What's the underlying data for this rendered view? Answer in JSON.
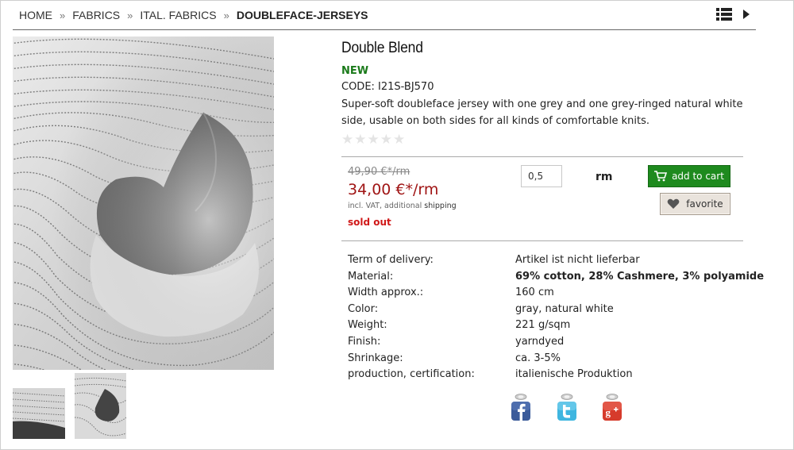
{
  "breadcrumb": {
    "items": [
      "HOME",
      "FABRICS",
      "ITAL. FABRICS"
    ],
    "separator": "»",
    "current": "DOUBLEFACE-JERSEYS"
  },
  "nav_icons": [
    "list-view-icon",
    "next-arrow-icon"
  ],
  "product": {
    "title": "Double Blend",
    "badge": "NEW",
    "code": "CODE: I21S-BJ570",
    "description": "Super-soft doubleface jersey with one grey and one grey-ringed natural white side, usable on both sides for all kinds of comfortable knits.",
    "rating_stars": 5,
    "rating_value": 0
  },
  "pricing": {
    "old_price": "49,90 €*/rm",
    "price": "34,00 €*/rm",
    "vat_prefix": "incl. VAT, additional",
    "vat_link": "shipping",
    "availability": "sold out"
  },
  "order": {
    "quantity": "0,5",
    "unit": "rm",
    "add_to_cart_label": "add to cart",
    "favorite_label": "favorite"
  },
  "specs": [
    {
      "key": "Term of delivery:",
      "value": "Artikel ist nicht lieferbar"
    },
    {
      "key": "Material:",
      "value": "69% cotton, 28% Cashmere, 3% polyamide"
    },
    {
      "key": "Width approx.:",
      "value": "160 cm"
    },
    {
      "key": "Color:",
      "value": "gray, natural white"
    },
    {
      "key": "Weight:",
      "value": "221 g/sqm"
    },
    {
      "key": "Finish:",
      "value": "yarndyed"
    },
    {
      "key": "Shrinkage:",
      "value": "ca. 3-5%"
    },
    {
      "key": "production, certification:",
      "value": "italienische Produktion"
    }
  ],
  "share": [
    "facebook-icon",
    "twitter-icon",
    "google-plus-icon"
  ],
  "colors": {
    "new_badge": "#1a7a1a",
    "price": "#a01515",
    "sold_out": "#d01818",
    "cart_button": "#1e8a1e",
    "favorite_button": "#e9e3dc"
  }
}
